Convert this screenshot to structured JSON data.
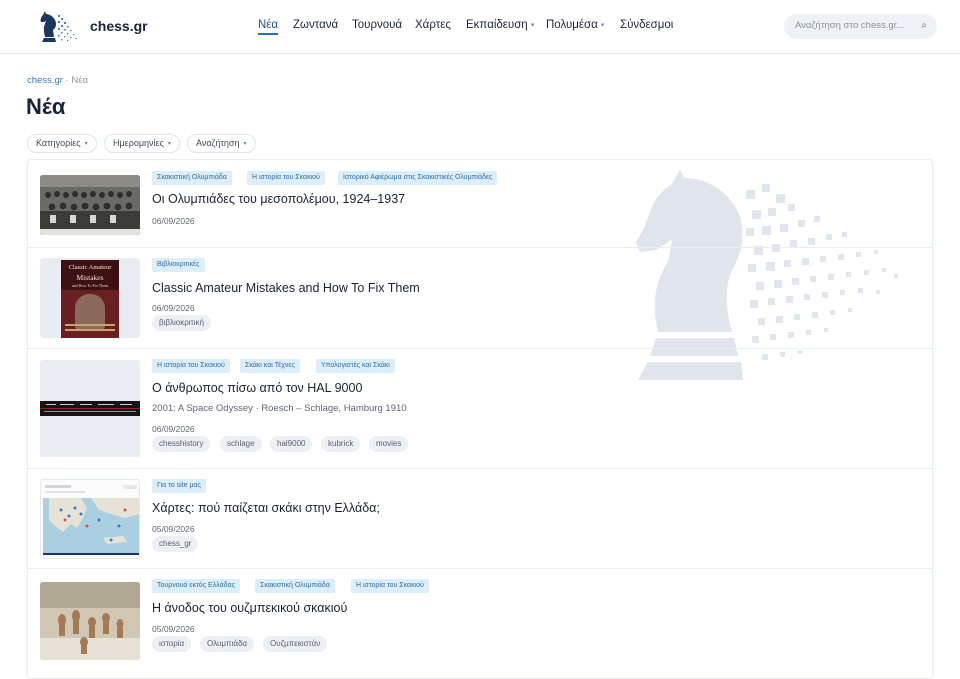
{
  "header": {
    "brand": "chess.gr",
    "nav": [
      {
        "label": "Νέα",
        "active": true,
        "dropdown": false
      },
      {
        "label": "Ζωντανά",
        "active": false,
        "dropdown": false
      },
      {
        "label": "Τουρνουά",
        "active": false,
        "dropdown": false
      },
      {
        "label": "Χάρτες",
        "active": false,
        "dropdown": false
      },
      {
        "label": "Εκπαίδευση",
        "active": false,
        "dropdown": true
      },
      {
        "label": "Πολυμέσα",
        "active": false,
        "dropdown": true
      },
      {
        "label": "Σύνδεσμοι",
        "active": false,
        "dropdown": false
      }
    ],
    "search_placeholder": "Αναζήτηση στο chess.gr...",
    "search_icon": "⌕"
  },
  "breadcrumb": {
    "root": "chess.gr",
    "separator": "·",
    "current": "Νέα"
  },
  "page_title": "Νέα",
  "filters": [
    {
      "label": "Κατηγορίες"
    },
    {
      "label": "Ημερομηνίες"
    },
    {
      "label": "Αναζήτηση"
    }
  ],
  "caret": "▾",
  "articles": [
    {
      "categories": [
        "Σκακιστική Ολυμπιάδα",
        "Η ιστορία του Σκακιού",
        "Ιστορικό Αφιέρωμα στις Σκακιστικές Ολυμπιάδες"
      ],
      "title": "Οι Ολυμπιάδες του μεσοπολέμου, 1924–1937",
      "subtitle": "",
      "date": "06/09/2026",
      "tags": []
    },
    {
      "categories": [
        "Βιβλιοκριτικές"
      ],
      "title": "Classic Amateur Mistakes and How To Fix Them",
      "subtitle": "",
      "date": "06/09/2026",
      "tags": [
        "βιβλιοκριτική"
      ],
      "book_cover": {
        "line1": "Classic Amateur",
        "line2": "Mistakes",
        "line3": "and How To Fix Them"
      }
    },
    {
      "categories": [
        "Η ιστορία του Σκακιού",
        "Σκάκι και Τέχνες",
        "Υπολογιστές και Σκάκι"
      ],
      "title": "Ο άνθρωπος πίσω από τον HAL 9000",
      "subtitle": "2001: A Space Odyssey · Roesch – Schlage, Hamburg 1910",
      "date": "06/09/2026",
      "tags": [
        "chesshistory",
        "schlage",
        "hal9000",
        "kubrick",
        "movies"
      ]
    },
    {
      "categories": [
        "Για το site μας"
      ],
      "title": "Χάρτες: πού παίζεται σκάκι στην Ελλάδα;",
      "subtitle": "",
      "date": "05/09/2026",
      "tags": [
        "chess_gr"
      ]
    },
    {
      "categories": [
        "Τουρνουά εκτός Ελλάδας",
        "Σκακιστική Ολυμπιάδα",
        "Η ιστορία του Σκακιού"
      ],
      "title": "Η άνοδος του ουζμπεκικού σκακιού",
      "subtitle": "",
      "date": "05/09/2026",
      "tags": [
        "ιστορία",
        "Ολυμπιάδα",
        "Ουζμπεκιστάν"
      ]
    }
  ],
  "colors": {
    "accent": "#2c6fb7",
    "category_bg": "#dbeefa",
    "category_text": "#2f6e9e",
    "tag_bg": "#eceff3",
    "navy": "#17223b"
  }
}
